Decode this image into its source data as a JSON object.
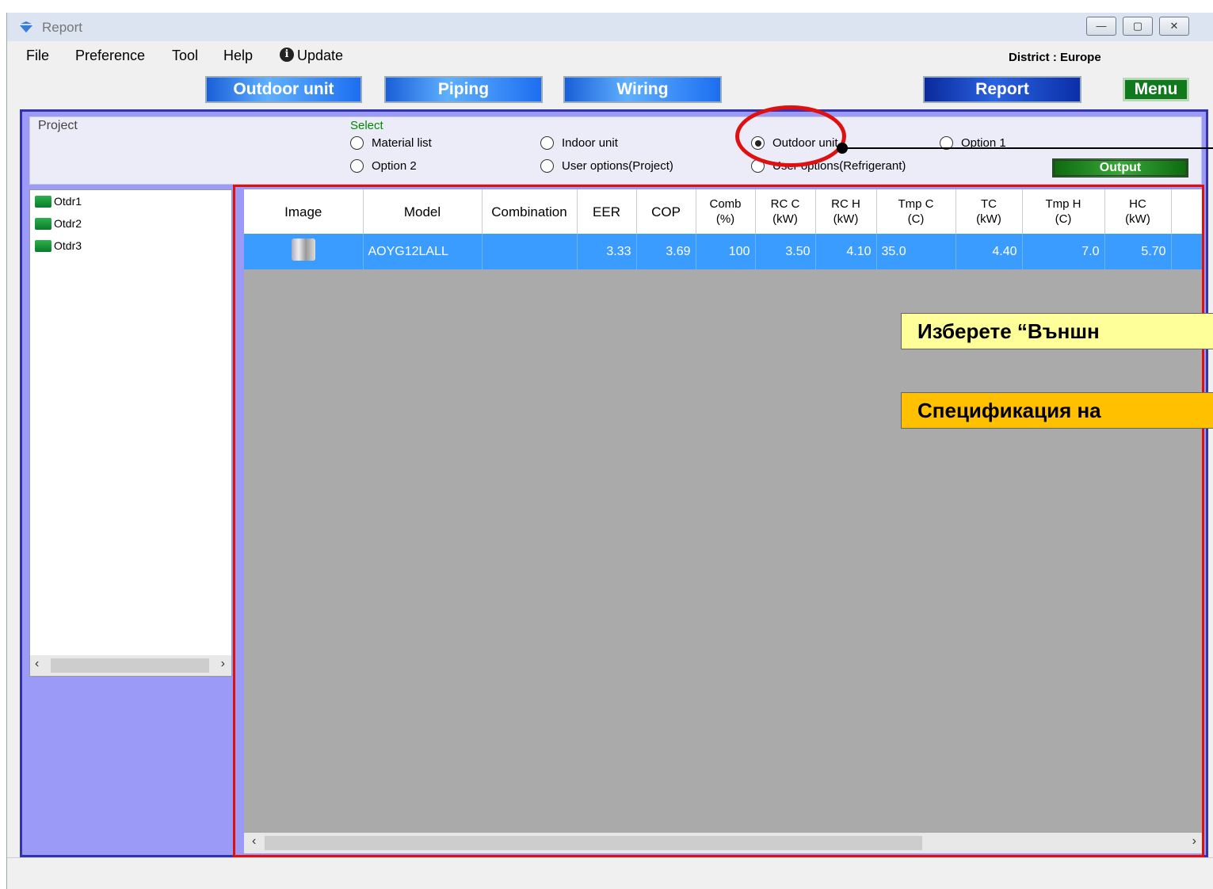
{
  "window": {
    "title": "Report",
    "minimize": "—",
    "maximize": "▢",
    "close": "✕"
  },
  "menu": {
    "file": "File",
    "preference": "Preference",
    "tool": "Tool",
    "help": "Help",
    "update": "Update",
    "district": "District : Europe"
  },
  "nav": {
    "outdoor": "Outdoor unit",
    "piping": "Piping",
    "wiring": "Wiring",
    "report": "Report",
    "menu": "Menu"
  },
  "panel": {
    "project_label": "Project",
    "select_label": "Select",
    "options": {
      "material_list": "Material list",
      "indoor_unit": "Indoor unit",
      "outdoor_unit": "Outdoor unit",
      "option1": "Option 1",
      "option2": "Option 2",
      "user_project": "User options(Project)",
      "user_refrigerant": "User options(Refrigerant)"
    },
    "selected": "Outdoor unit",
    "output": "Output"
  },
  "tree": {
    "items": [
      "Otdr1",
      "Otdr2",
      "Otdr3"
    ]
  },
  "table": {
    "headers": {
      "image": "Image",
      "model": "Model",
      "combination": "Combination",
      "eer": "EER",
      "cop": "COP",
      "comb1": "Comb",
      "comb2": "(%)",
      "rcc1": "RC C",
      "rcc2": "(kW)",
      "rch1": "RC H",
      "rch2": "(kW)",
      "tmpc1": "Tmp C",
      "tmpc2": "(C)",
      "tc1": "TC",
      "tc2": "(kW)",
      "tmph1": "Tmp H",
      "tmph2": "(C)",
      "hc1": "HC",
      "hc2": "(kW)"
    },
    "row": {
      "model": "AOYG12LALL",
      "combination": "",
      "eer": "3.33",
      "cop": "3.69",
      "comb": "100",
      "rcc": "3.50",
      "rch": "4.10",
      "tmpc": "35.0",
      "tc": "4.40",
      "tmph": "7.0",
      "hc": "5.70"
    }
  },
  "callouts": {
    "select": "Изберете “Външн",
    "spec": "Спецификация на"
  },
  "colors": {
    "callout1": "#ffff99",
    "callout2": "#ffc000",
    "highlight": "#e01010",
    "selected_row": "#3b9cff"
  }
}
